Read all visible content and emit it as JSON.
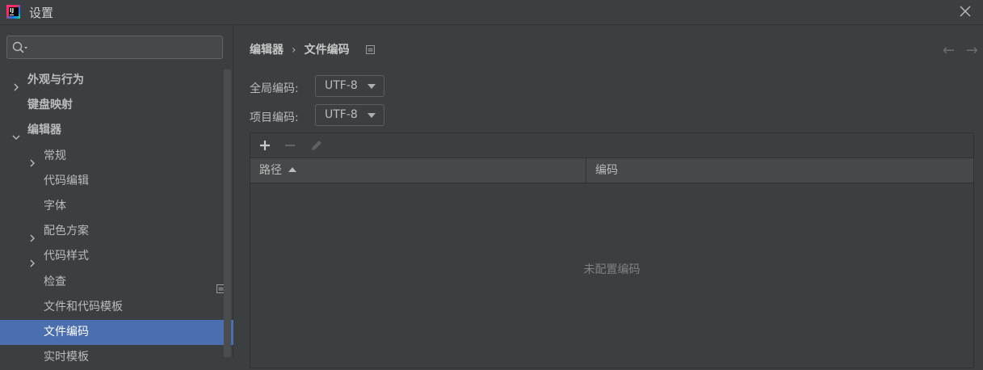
{
  "window": {
    "title": "设置"
  },
  "sidebar": {
    "search": {
      "value": "",
      "placeholder": ""
    },
    "items": [
      {
        "label": "外观与行为",
        "level": 0,
        "arrow": "right"
      },
      {
        "label": "键盘映射",
        "level": 0,
        "arrow": "none"
      },
      {
        "label": "编辑器",
        "level": 0,
        "arrow": "down"
      },
      {
        "label": "常规",
        "level": 1,
        "arrow": "right"
      },
      {
        "label": "代码编辑",
        "level": 1,
        "arrow": "none"
      },
      {
        "label": "字体",
        "level": 1,
        "arrow": "none"
      },
      {
        "label": "配色方案",
        "level": 1,
        "arrow": "right"
      },
      {
        "label": "代码样式",
        "level": 1,
        "arrow": "right"
      },
      {
        "label": "检查",
        "level": 1,
        "arrow": "none",
        "project_icon": true
      },
      {
        "label": "文件和代码模板",
        "level": 1,
        "arrow": "none"
      },
      {
        "label": "文件编码",
        "level": 1,
        "arrow": "none",
        "project_icon": true,
        "selected": true
      },
      {
        "label": "实时模板",
        "level": 1,
        "arrow": "none"
      }
    ]
  },
  "main": {
    "breadcrumb": {
      "parent": "编辑器",
      "separator": "›",
      "current": "文件编码"
    },
    "global_encoding": {
      "label": "全局编码:",
      "value": "UTF-8"
    },
    "project_encoding": {
      "label": "项目编码:",
      "value": "UTF-8"
    },
    "table": {
      "columns": [
        {
          "label": "路径",
          "sort": "asc"
        },
        {
          "label": "编码"
        }
      ],
      "empty_text": "未配置编码"
    }
  },
  "colors": {
    "background": "#3c3f41",
    "selection": "#4b6eaf",
    "text": "#bbbbbb",
    "border": "#323232"
  },
  "icons": [
    "app-icon",
    "close-icon",
    "search-icon",
    "chevron-right-icon",
    "chevron-down-icon",
    "project-level-icon",
    "back-arrow-icon",
    "forward-arrow-icon",
    "add-icon",
    "remove-icon",
    "edit-icon"
  ]
}
